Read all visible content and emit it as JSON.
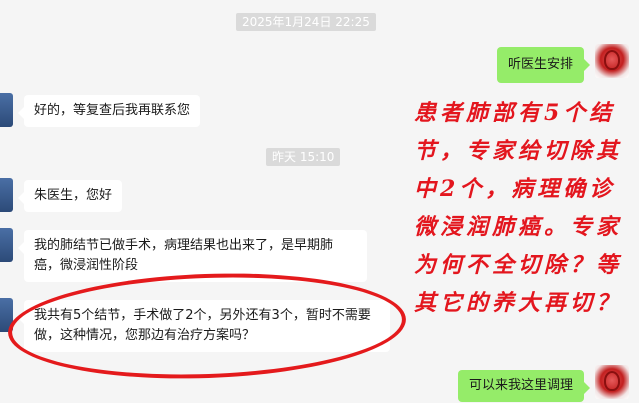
{
  "chat": {
    "timestamp1": "2025年1月24日 22:25",
    "timestamp2": "昨天 15:10",
    "messages": [
      {
        "side": "right",
        "text": "听医生安排"
      },
      {
        "side": "left",
        "text": "好的，等复查后我再联系您"
      },
      {
        "side": "left",
        "text": "朱医生，您好"
      },
      {
        "side": "left",
        "text": "我的肺结节已做手术，病理结果也出来了，是早期肺癌，微浸润性阶段"
      },
      {
        "side": "left",
        "text": "我共有5个结节，手术做了2个，另外还有3个，暂时不需要做，这种情况，您那边有治疗方案吗？"
      },
      {
        "side": "right",
        "text": "可以来我这里调理"
      }
    ]
  },
  "annotation": {
    "text": "患者肺部有5个结节，专家给切除其中2个，病理确诊微浸润肺癌。专家为何不全切除？等其它的养大再切？",
    "color": "#e3161e"
  },
  "colors": {
    "background": "#f5f5f5",
    "bubble_right": "#95ec69",
    "bubble_left": "#ffffff",
    "highlight_circle": "#e41a1c"
  }
}
